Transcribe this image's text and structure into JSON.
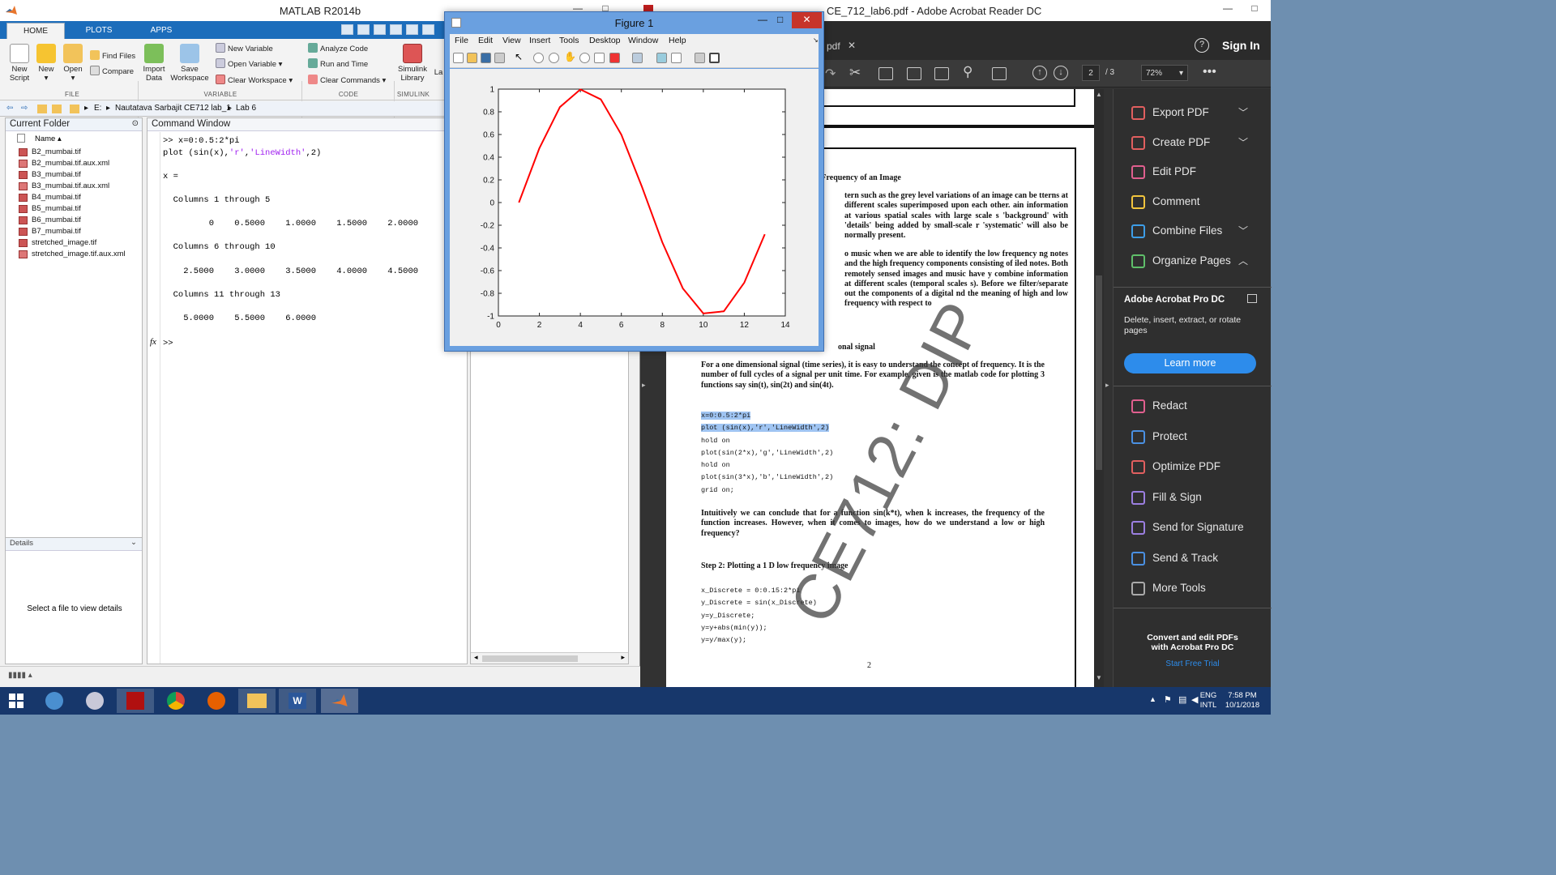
{
  "matlab": {
    "title": "MATLAB R2014b",
    "tabs": [
      "HOME",
      "PLOTS",
      "APPS"
    ],
    "ribbon": {
      "new_script": [
        "New",
        "Script"
      ],
      "new": "New",
      "open": "Open",
      "find_files": "Find Files",
      "compare": "Compare",
      "import_data": [
        "Import",
        "Data"
      ],
      "save_workspace": [
        "Save",
        "Workspace"
      ],
      "new_variable": "New Variable",
      "open_variable": "Open Variable",
      "clear_workspace": "Clear Workspace",
      "analyze_code": "Analyze Code",
      "run_and_time": "Run and Time",
      "clear_commands": "Clear Commands",
      "simulink_library": [
        "Simulink",
        "Library"
      ],
      "layout_partial": "La",
      "groups": [
        "FILE",
        "VARIABLE",
        "CODE",
        "SIMULINK"
      ]
    },
    "path": [
      "E:",
      "Nautatava Sarbajit CE712 lab_1",
      "Lab 6"
    ],
    "current_folder": {
      "title": "Current Folder",
      "column": "Name",
      "files": [
        "B2_mumbai.tif",
        "B2_mumbai.tif.aux.xml",
        "B3_mumbai.tif",
        "B3_mumbai.tif.aux.xml",
        "B4_mumbai.tif",
        "B5_mumbai.tif",
        "B6_mumbai.tif",
        "B7_mumbai.tif",
        "stretched_image.tif",
        "stretched_image.tif.aux.xml"
      ]
    },
    "details": {
      "title": "Details",
      "message": "Select a file to view details"
    },
    "command_window": {
      "title": "Command Window",
      "prompt1": ">> x=0:0.5:2*pi",
      "plot_cmd_a": "plot (sin(x),",
      "plot_str1": "'r'",
      "plot_cmd_b": ",",
      "plot_str2": "'LineWidth'",
      "plot_cmd_c": ",2)",
      "output": "\nx =\n\n  Columns 1 through 5\n\n         0    0.5000    1.0000    1.5000    2.0000\n\n  Columns 6 through 10\n\n    2.5000    3.0000    3.5000    4.0000    4.5000\n\n  Columns 11 through 13\n\n    5.0000    5.5000    6.0000\n",
      "fx": "fx",
      "prompt": ">>"
    }
  },
  "figure": {
    "title": "Figure 1",
    "menu": [
      "File",
      "Edit",
      "View",
      "Insert",
      "Tools",
      "Desktop",
      "Window",
      "Help"
    ],
    "chart_data": {
      "type": "line",
      "x": [
        1,
        2,
        3,
        4,
        5,
        6,
        7,
        8,
        9,
        10,
        11,
        12,
        13
      ],
      "y": [
        0,
        0.4794,
        0.8415,
        0.9975,
        0.9093,
        0.5985,
        0.1411,
        -0.3508,
        -0.7568,
        -0.9775,
        -0.9589,
        -0.7055,
        -0.2794
      ],
      "color": "#ff0000",
      "xlim": [
        0,
        14
      ],
      "ylim": [
        -1,
        1
      ],
      "xticks": [
        0,
        2,
        4,
        6,
        8,
        10,
        12,
        14
      ],
      "yticks": [
        -1,
        -0.8,
        -0.6,
        -0.4,
        -0.2,
        0,
        0.2,
        0.4,
        0.6,
        0.8,
        1
      ],
      "xtick_labels": [
        "0",
        "2",
        "4",
        "6",
        "8",
        "10",
        "12",
        "14"
      ],
      "ytick_labels": [
        "-1",
        "-0.8",
        "-0.6",
        "-0.4",
        "-0.2",
        "0",
        "0.2",
        "0.4",
        "0.6",
        "0.8",
        "1"
      ],
      "grid": false
    }
  },
  "acrobat": {
    "title": "CE_712_lab6.pdf - Adobe Acrobat Reader DC",
    "tab_partial": "pdf",
    "sign_in": "Sign In",
    "page_current": "2",
    "page_total": "/ 3",
    "zoom": "72%",
    "watermark": "CE712: DIP",
    "document": {
      "heading1": "atial Frequency of an Image",
      "para1": "tern such as the grey level variations of an image can be tterns at different scales superimposed upon each other. ain information at various spatial scales with large scale s 'background' with 'details' being added by small-scale r 'systematic' will also be normally present.",
      "para2": "o music when we are able to identify the low frequency ng notes and the high frequency components consisting of iled notes. Both remotely sensed images and music have y combine information at different scales (temporal scales s). Before we filter/separate out the components of a digital nd the meaning of high and low frequency with respect to",
      "heading2": "onal signal",
      "para3": "For a one dimensional signal (time series), it is easy to understand the concept of frequency. It is the number of full cycles of a signal per unit time. For example, given is the matlab code for plotting 3 functions say sin(t), sin(2t) and sin(4t).",
      "code1_hl1": "x=0:0.5:2*pi",
      "code1_hl2": "plot (sin(x),'r','LineWidth',2)",
      "code1_rest": "hold on\nplot(sin(2*x),'g','LineWidth',2)\nhold on\nplot(sin(3*x),'b','LineWidth',2)\ngrid on;",
      "para4": "Intuitively we can conclude that for a function sin(k*t), when k increases, the frequency of the function increases. However, when it comes to images, how do we understand a low or high frequency?",
      "heading3": "Step 2: Plotting a 1 D low frequency image",
      "code2": "x_Discrete = 0:0.15:2*pi\ny_Discrete = sin(x_Discrete)\ny=y_Discrete;\ny=y+abs(min(y));\ny=y/max(y);",
      "page_number": "2"
    },
    "tools": [
      {
        "label": "Export PDF",
        "icon": "export-pdf-icon",
        "color": "#e15f5f",
        "chevron": "down"
      },
      {
        "label": "Create PDF",
        "icon": "create-pdf-icon",
        "color": "#e15f5f",
        "chevron": "down"
      },
      {
        "label": "Edit PDF",
        "icon": "edit-pdf-icon",
        "color": "#e15f8f",
        "chevron": ""
      },
      {
        "label": "Comment",
        "icon": "comment-icon",
        "color": "#f2c53d",
        "chevron": ""
      },
      {
        "label": "Combine Files",
        "icon": "combine-files-icon",
        "color": "#3d9ee8",
        "chevron": "down"
      },
      {
        "label": "Organize Pages",
        "icon": "organize-pages-icon",
        "color": "#5fbf6a",
        "chevron": "up"
      }
    ],
    "promo": {
      "title": "Adobe Acrobat Pro DC",
      "text": "Delete, insert, extract, or rotate pages",
      "button": "Learn more"
    },
    "tools2": [
      {
        "label": "Redact",
        "icon": "redact-icon",
        "color": "#e15f8f"
      },
      {
        "label": "Protect",
        "icon": "protect-icon",
        "color": "#4a90e2"
      },
      {
        "label": "Optimize PDF",
        "icon": "optimize-pdf-icon",
        "color": "#e15f5f"
      },
      {
        "label": "Fill & Sign",
        "icon": "fill-sign-icon",
        "color": "#9b7fe0"
      },
      {
        "label": "Send for Signature",
        "icon": "send-signature-icon",
        "color": "#9b7fe0"
      },
      {
        "label": "Send & Track",
        "icon": "send-track-icon",
        "color": "#4a90e2"
      },
      {
        "label": "More Tools",
        "icon": "more-tools-icon",
        "color": "#aaaaaa"
      }
    ],
    "footer": {
      "line1": "Convert and edit PDFs",
      "line2": "with Acrobat Pro DC",
      "link": "Start Free Trial"
    }
  },
  "taskbar": {
    "lang1": "ENG",
    "lang2": "INTL",
    "time": "7:58 PM",
    "date": "10/1/2018",
    "word_label": "W"
  },
  "colors": {
    "matlab_blue": "#1c6dbb",
    "acrobat_dark": "#323232",
    "learn_more": "#2d8ceb",
    "taskbar": "#17376b"
  }
}
